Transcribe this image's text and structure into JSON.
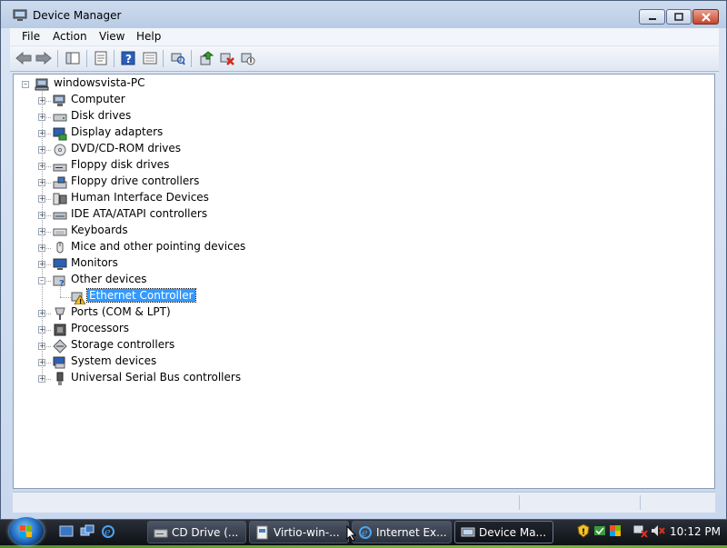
{
  "window": {
    "title": "Device Manager",
    "title_icon": "device-manager-icon"
  },
  "menu": [
    "File",
    "Action",
    "View",
    "Help"
  ],
  "toolbar": {
    "buttons": [
      "back-arrow-icon",
      "forward-arrow-icon",
      "console-tree-icon",
      "properties-icon",
      "help-icon",
      "view-icon",
      "scan-hardware-icon",
      "update-driver-icon",
      "uninstall-icon",
      "disable-icon"
    ]
  },
  "tree": {
    "root": "windowsvista-PC",
    "items": [
      {
        "label": "Computer",
        "icon": "computer-icon",
        "expander": "+"
      },
      {
        "label": "Disk drives",
        "icon": "disk-drive-icon",
        "expander": "+"
      },
      {
        "label": "Display adapters",
        "icon": "display-adapter-icon",
        "expander": "+"
      },
      {
        "label": "DVD/CD-ROM drives",
        "icon": "dvd-drive-icon",
        "expander": "+"
      },
      {
        "label": "Floppy disk drives",
        "icon": "floppy-disk-icon",
        "expander": "+"
      },
      {
        "label": "Floppy drive controllers",
        "icon": "floppy-controller-icon",
        "expander": "+"
      },
      {
        "label": "Human Interface Devices",
        "icon": "hid-icon",
        "expander": "+"
      },
      {
        "label": "IDE ATA/ATAPI controllers",
        "icon": "ide-controller-icon",
        "expander": "+"
      },
      {
        "label": "Keyboards",
        "icon": "keyboard-icon",
        "expander": "+"
      },
      {
        "label": "Mice and other pointing devices",
        "icon": "mouse-icon",
        "expander": "+"
      },
      {
        "label": "Monitors",
        "icon": "monitor-icon",
        "expander": "+"
      },
      {
        "label": "Other devices",
        "icon": "other-devices-icon",
        "expander": "-"
      },
      {
        "label": "Ports (COM & LPT)",
        "icon": "port-icon",
        "expander": "+"
      },
      {
        "label": "Processors",
        "icon": "processor-icon",
        "expander": "+"
      },
      {
        "label": "Storage controllers",
        "icon": "storage-controller-icon",
        "expander": "+"
      },
      {
        "label": "System devices",
        "icon": "system-devices-icon",
        "expander": "+"
      },
      {
        "label": "Universal Serial Bus controllers",
        "icon": "usb-icon",
        "expander": "+"
      }
    ],
    "child": {
      "label": "Ethernet Controller",
      "icon": "warning-device-icon",
      "parent": "Other devices"
    }
  },
  "taskbar": {
    "tasks": [
      {
        "label": "CD Drive (...",
        "icon": "cd-drive-icon"
      },
      {
        "label": "Virtio-win-...",
        "icon": "folder-icon"
      },
      {
        "label": "Internet Ex...",
        "icon": "internet-explorer-icon"
      },
      {
        "label": "Device Ma...",
        "icon": "device-manager-icon"
      }
    ],
    "quick_launch": [
      "show-desktop-icon",
      "switch-windows-icon",
      "internet-explorer-icon"
    ],
    "tray_icons": [
      "security-warning-icon",
      "network-icon",
      "volume-muted-icon"
    ],
    "clock": "10:12 PM"
  },
  "colors": {
    "selection": "#3399ff",
    "warning": "#f2c12e"
  }
}
